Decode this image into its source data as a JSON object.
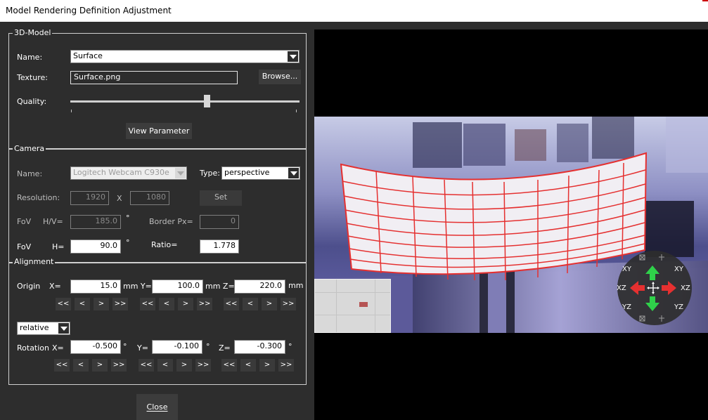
{
  "window": {
    "title": "Model Rendering Definition Adjustment"
  },
  "model_group": {
    "title": "3D-Model",
    "name_label": "Name:",
    "name_value": "Surface",
    "texture_label": "Texture:",
    "texture_value": "Surface.png",
    "browse_label": "Browse...",
    "quality_label": "Quality:",
    "quality_value": 0.6,
    "view_parameter_label": "View Parameter"
  },
  "camera_group": {
    "title": "Camera",
    "name_label": "Name:",
    "name_value": "Logitech Webcam C930e",
    "type_label": "Type:",
    "type_value": "perspective",
    "resolution_label": "Resolution:",
    "resolution_w": "1920",
    "resolution_x": "X",
    "resolution_h": "1080",
    "set_label": "Set",
    "fov_label": "FoV",
    "hv_label": "H/V=",
    "fov_hv_value": "185.0",
    "degree": "°",
    "border_label": "Border Px=",
    "border_value": "0",
    "fov2_label": "FoV",
    "h_label": "H=",
    "fov_h_value": "90.0",
    "ratio_label": "Ratio=",
    "ratio_value": "1.778"
  },
  "alignment_group": {
    "title": "Alignment",
    "origin_label": "Origin",
    "x_label": "X=",
    "origin_x": "15.0",
    "mm_y_label": "mm Y=",
    "origin_y": "100.0",
    "mm_z_label": "mm Z=",
    "origin_z": "220.0",
    "mm_label": "mm",
    "mode_value": "relative",
    "rotation_label": "Rotation",
    "rx_label": "X=",
    "rotation_x": "-0.500",
    "deg": "°",
    "ry_label": "Y=",
    "rotation_y": "-0.100",
    "rz_label": "Z=",
    "rotation_z": "-0.300",
    "steps": [
      "<<",
      "<",
      ">",
      ">>"
    ]
  },
  "close_label": "Close",
  "nav_widget": {
    "xy_left": "XY",
    "xy_right": "XY",
    "xz_left": "XZ",
    "xz_right": "XZ",
    "yz_left": "YZ",
    "yz_right": "YZ"
  },
  "colors": {
    "background": "#2d2d2d",
    "grid_line": "#e53030",
    "arrow_green": "#2fd14a",
    "arrow_red": "#e53030"
  },
  "icons": [
    "move-icon",
    "reset-icon"
  ]
}
